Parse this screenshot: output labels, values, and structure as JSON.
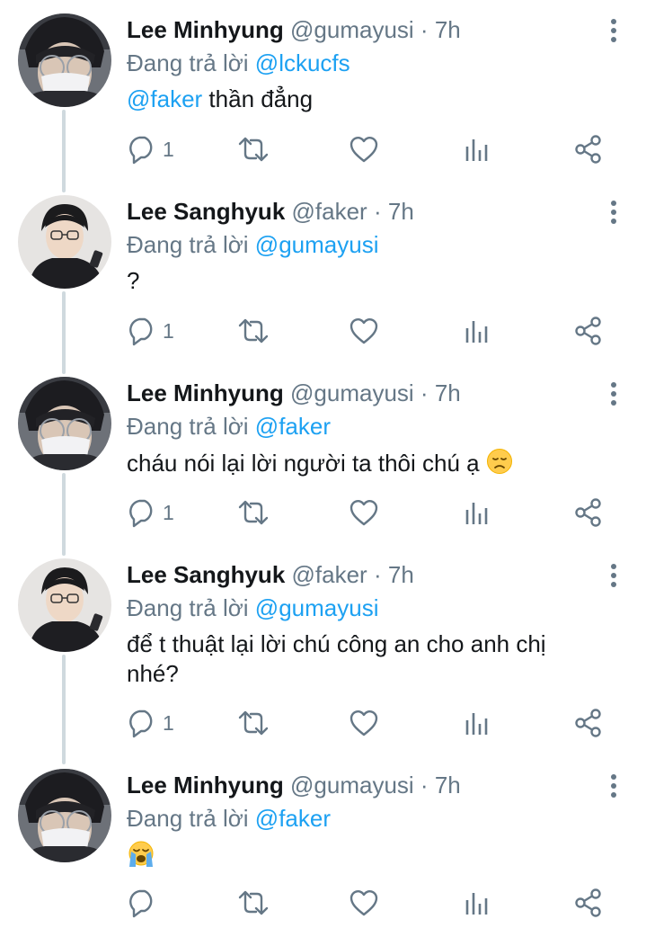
{
  "tweets": [
    {
      "name": "Lee Minhyung",
      "handle": "@gumayusi",
      "dot": "·",
      "time": "7h",
      "reply_prefix": "Đang trả lời",
      "reply_to": "@lckucfs",
      "text_mention": "@faker",
      "text": " thần đẳng",
      "emoji": "",
      "reply_count": "1",
      "avatar": "gumayusi-avatar"
    },
    {
      "name": "Lee Sanghyuk",
      "handle": "@faker",
      "dot": "·",
      "time": "7h",
      "reply_prefix": "Đang trả lời",
      "reply_to": "@gumayusi",
      "text_mention": "",
      "text": "?",
      "emoji": "",
      "reply_count": "1",
      "avatar": "faker-avatar"
    },
    {
      "name": "Lee Minhyung",
      "handle": "@gumayusi",
      "dot": "·",
      "time": "7h",
      "reply_prefix": "Đang trả lời",
      "reply_to": "@faker",
      "text_mention": "",
      "text": "cháu nói lại lời người ta thôi chú ạ ",
      "emoji": "disappointed-face",
      "reply_count": "1",
      "avatar": "gumayusi-avatar"
    },
    {
      "name": "Lee Sanghyuk",
      "handle": "@faker",
      "dot": "·",
      "time": "7h",
      "reply_prefix": "Đang trả lời",
      "reply_to": "@gumayusi",
      "text_mention": "",
      "text": "để t thuật lại lời chú công an cho anh chị nhé?",
      "emoji": "",
      "reply_count": "1",
      "avatar": "faker-avatar"
    },
    {
      "name": "Lee Minhyung",
      "handle": "@gumayusi",
      "dot": "·",
      "time": "7h",
      "reply_prefix": "Đang trả lời",
      "reply_to": "@faker",
      "text_mention": "",
      "text": "",
      "emoji": "loudly-crying-face",
      "reply_count": "",
      "avatar": "gumayusi-avatar"
    }
  ],
  "icons": {
    "reply": "reply-icon",
    "retweet": "retweet-icon",
    "like": "heart-icon",
    "views": "analytics-icon",
    "share": "share-icon",
    "more": "more-options-icon"
  },
  "colors": {
    "link": "#1da1f2",
    "secondary": "#657786",
    "thread": "#cfd9de"
  }
}
